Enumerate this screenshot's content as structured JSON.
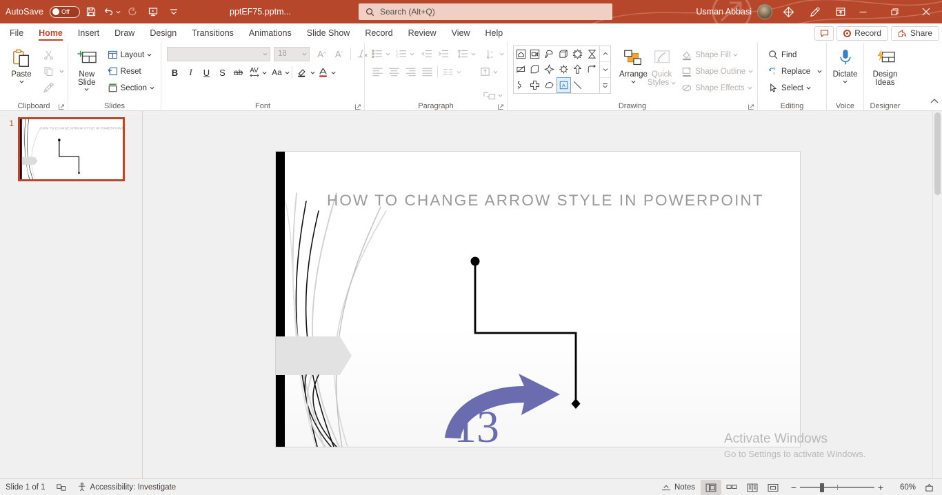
{
  "titlebar": {
    "autosave_label": "AutoSave",
    "autosave_state": "Off",
    "document_title": "pptEF75.pptm...",
    "quick_access": [
      {
        "name": "save-button",
        "label": "Save"
      },
      {
        "name": "undo-button",
        "label": "Undo"
      },
      {
        "name": "redo-button",
        "label": "Redo"
      },
      {
        "name": "start-from-beginning-button",
        "label": "Start From Beginning"
      },
      {
        "name": "customize-quick-access-toolbar-button",
        "label": "Customize Quick Access Toolbar"
      }
    ],
    "user_name": "Usman Abbasi",
    "icons": [
      "diamond-icon",
      "pen-icon",
      "ribbon-display-options-icon"
    ],
    "window_controls": [
      "minimize",
      "restore",
      "close"
    ],
    "accent_color": "#b7472a"
  },
  "search": {
    "placeholder": "Search (Alt+Q)",
    "icon": "search-icon"
  },
  "tabs": [
    {
      "label": "File",
      "active": false
    },
    {
      "label": "Home",
      "active": true
    },
    {
      "label": "Insert",
      "active": false
    },
    {
      "label": "Draw",
      "active": false
    },
    {
      "label": "Design",
      "active": false
    },
    {
      "label": "Transitions",
      "active": false
    },
    {
      "label": "Animations",
      "active": false
    },
    {
      "label": "Slide Show",
      "active": false
    },
    {
      "label": "Record",
      "active": false
    },
    {
      "label": "Review",
      "active": false
    },
    {
      "label": "View",
      "active": false
    },
    {
      "label": "Help",
      "active": false
    }
  ],
  "tabbar_right": {
    "comments_label": "Comments",
    "record_label": "Record",
    "share_label": "Share"
  },
  "ribbon": {
    "groups": [
      {
        "name": "Clipboard",
        "label": "Clipboard",
        "paste_label": "Paste",
        "items": [
          "Cut",
          "Copy",
          "Format Painter"
        ]
      },
      {
        "name": "Slides",
        "label": "Slides",
        "new_slide_label": "New Slide",
        "layout_label": "Layout",
        "reset_label": "Reset",
        "section_label": "Section"
      },
      {
        "name": "Font",
        "label": "Font",
        "font_name_value": "",
        "font_size_value": "18",
        "buttons": [
          "Increase Font Size",
          "Decrease Font Size",
          "Clear All Formatting",
          "Bold",
          "Italic",
          "Underline",
          "Text Shadow",
          "Strikethrough",
          "Character Spacing",
          "Change Case",
          "Text Highlight Color",
          "Font Color"
        ],
        "bold": "B",
        "italic": "I",
        "underline": "U",
        "shadow": "S",
        "strike": "ab",
        "spacing": "AV",
        "case": "Aa"
      },
      {
        "name": "Paragraph",
        "label": "Paragraph",
        "buttons": [
          "Bullets",
          "Numbering",
          "Decrease List Level",
          "Increase List Level",
          "Line Spacing",
          "Align Left",
          "Center",
          "Align Right",
          "Justify",
          "Columns",
          "Text Direction",
          "Align Text",
          "Convert to SmartArt"
        ]
      },
      {
        "name": "Drawing",
        "label": "Drawing",
        "arrange_label": "Arrange",
        "quick_styles_label": "Quick Styles",
        "shape_fill_label": "Shape Fill",
        "shape_outline_label": "Shape Outline",
        "shape_effects_label": "Shape Effects",
        "shapes": [
          "home-shape",
          "video-shape",
          "cloud-callout-shape",
          "cube-shape",
          "explosion-shape",
          "hourglass-shape",
          "no-symbol-shape",
          "pentagon-shape",
          "four-point-star-shape",
          "gear-shape",
          "up-arrow-shape",
          "elbow-connector-shape",
          "curved-arrow-shape",
          "cross-shape",
          "cloud-shape",
          "text-box-shape",
          "line-shape",
          "line-arrow-shape"
        ],
        "selected_shape_index": 15
      },
      {
        "name": "Editing",
        "label": "Editing",
        "find_label": "Find",
        "replace_label": "Replace",
        "select_label": "Select"
      },
      {
        "name": "Voice",
        "label": "Voice",
        "dictate_label": "Dictate"
      },
      {
        "name": "Designer",
        "label": "Designer",
        "design_ideas_label": "Design\nIdeas",
        "design_ideas_line1": "Design",
        "design_ideas_line2": "Ideas"
      }
    ],
    "collapse_label": "Collapse the Ribbon"
  },
  "thumbnails": [
    {
      "number": "1",
      "title": "HOW TO CHANGE ARROW STYLE IN POWERPOINT",
      "selected": true
    }
  ],
  "slide": {
    "title": "HOW TO CHANGE ARROW STYLE IN POWERPOINT",
    "title_color": "#9a9a9a",
    "annotation_number": "13",
    "annotation_color": "#6b6bb0",
    "connector": {
      "start_marker": "oval",
      "end_marker": "diamond",
      "color": "#000000"
    }
  },
  "watermark": {
    "line1": "Activate Windows",
    "line2": "Go to Settings to activate Windows."
  },
  "statusbar": {
    "slide_count": "Slide 1 of 1",
    "language_icon": "language-icon",
    "accessibility": "Accessibility: Investigate",
    "notes_label": "Notes",
    "views": [
      "Normal",
      "Slide Sorter",
      "Reading View",
      "Slide Show"
    ],
    "active_view": "Normal",
    "zoom_out": "−",
    "zoom_in": "+",
    "zoom_level": "60%",
    "fit_label": "Fit slide to current window"
  }
}
